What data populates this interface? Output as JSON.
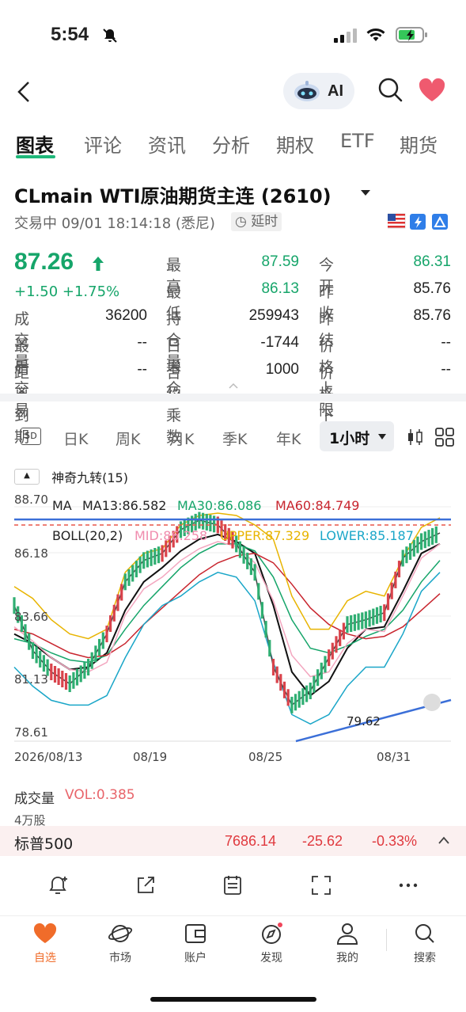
{
  "status": {
    "time": "5:54"
  },
  "header": {
    "ai_label": "AI"
  },
  "tabs": [
    "图表",
    "评论",
    "资讯",
    "分析",
    "期权",
    "ETF",
    "期货"
  ],
  "instrument": {
    "title": "CLmain   WTI原油期货主连 (2610)",
    "status_line": "交易中 09/01 18:14:18 (悉尼)",
    "delay": "延时",
    "price": "87.26",
    "change": "+1.50  +1.75%"
  },
  "quote_grid": [
    {
      "label": "最高",
      "value": "87.59",
      "green": true
    },
    {
      "label": "今开",
      "value": "86.31",
      "green": true
    },
    {
      "label": "最低",
      "value": "86.13",
      "green": true
    },
    {
      "label": "昨收",
      "value": "85.76",
      "green": false
    },
    {
      "label": "成交量",
      "value": "36200",
      "green": false
    },
    {
      "label": "持仓量",
      "value": "259943",
      "green": false
    },
    {
      "label": "昨结",
      "value": "85.76",
      "green": false
    },
    {
      "label": "最后交易",
      "value": "--",
      "green": false
    },
    {
      "label": "日增仓",
      "value": "-1744",
      "green": false
    },
    {
      "label": "价格上限",
      "value": "--",
      "green": false
    },
    {
      "label": "距离到期",
      "value": "--",
      "green": false
    },
    {
      "label": "合约乘数",
      "value": "1000",
      "green": false
    },
    {
      "label": "价格下限",
      "value": "--",
      "green": false
    }
  ],
  "periods": {
    "badge": "5D",
    "items": [
      "日K",
      "周K",
      "月K",
      "季K",
      "年K"
    ],
    "active": "1小时"
  },
  "indicators": {
    "magic": "神奇九转(15)",
    "ma_label": "MA",
    "ma13": "MA13:86.582",
    "ma30": "MA30:86.086",
    "ma60": "MA60:84.749",
    "boll": "BOLL(20,2)",
    "mid": "MID:86.258",
    "upper": "UPPER:87.329",
    "lower": "LOWER:85.187"
  },
  "chart_data": {
    "type": "line",
    "title": "",
    "y_ticks": [
      "88.70",
      "86.18",
      "83.66",
      "81.13",
      "78.61"
    ],
    "x_ticks": [
      "2026/08/13",
      "08/19",
      "08/25",
      "08/31"
    ],
    "ylim": [
      78.61,
      88.7
    ],
    "low_annotation": "79.62",
    "series": [
      {
        "name": "MA13",
        "color": "#111111",
        "values": [
          83.0,
          82.6,
          82.0,
          81.5,
          81.6,
          82.2,
          84.0,
          85.2,
          85.8,
          86.5,
          87.0,
          87.2,
          86.9,
          86.4,
          84.2,
          81.4,
          80.4,
          81.0,
          82.4,
          83.2,
          83.3,
          84.8,
          86.4,
          86.8
        ]
      },
      {
        "name": "MA30",
        "color": "#16a56a",
        "values": [
          82.8,
          82.6,
          82.2,
          81.9,
          81.8,
          82.1,
          83.2,
          84.2,
          85.0,
          85.8,
          86.4,
          86.8,
          86.8,
          86.5,
          85.4,
          83.6,
          82.4,
          82.2,
          82.5,
          82.9,
          83.2,
          84.0,
          85.2,
          86.1
        ]
      },
      {
        "name": "MA60",
        "color": "#c8252e",
        "values": [
          83.2,
          83.0,
          82.6,
          82.2,
          82.0,
          82.1,
          82.6,
          83.4,
          84.1,
          84.8,
          85.5,
          86.0,
          86.3,
          86.4,
          86.0,
          85.1,
          84.1,
          83.4,
          83.0,
          82.8,
          82.9,
          83.3,
          84.0,
          84.7
        ]
      },
      {
        "name": "UPPER",
        "color": "#e8b400",
        "values": [
          85.0,
          84.5,
          83.6,
          83.0,
          82.8,
          83.2,
          85.6,
          86.4,
          86.6,
          87.6,
          88.0,
          88.1,
          88.0,
          87.6,
          87.0,
          84.6,
          83.2,
          83.2,
          84.4,
          84.8,
          84.6,
          86.2,
          87.5,
          87.9
        ]
      },
      {
        "name": "LOWER",
        "color": "#1aa6c8",
        "values": [
          81.6,
          80.8,
          80.2,
          80.0,
          80.0,
          80.4,
          82.0,
          83.4,
          84.2,
          84.6,
          85.2,
          85.6,
          85.4,
          84.4,
          81.8,
          79.6,
          79.2,
          79.6,
          80.8,
          81.6,
          81.6,
          83.0,
          84.8,
          85.6
        ]
      },
      {
        "name": "MID",
        "color": "#f3a6bf",
        "values": [
          83.3,
          82.7,
          82.0,
          81.5,
          81.4,
          81.8,
          83.8,
          84.9,
          85.4,
          86.1,
          86.6,
          86.9,
          86.7,
          86.0,
          84.4,
          82.1,
          81.2,
          81.4,
          82.6,
          83.2,
          83.1,
          84.6,
          86.2,
          86.8
        ]
      },
      {
        "name": "",
        "color": "#444444",
        "values": [
          84.2,
          82.3,
          81.4,
          80.9,
          81.6,
          83.0,
          85.2,
          86.1,
          86.4,
          87.4,
          87.8,
          87.6,
          86.8,
          85.6,
          81.6,
          80.0,
          80.6,
          82.0,
          83.4,
          83.6,
          83.9,
          86.2,
          86.9,
          87.26
        ]
      }
    ]
  },
  "volume": {
    "label": "成交量",
    "vol": "VOL:0.385",
    "scale": "4万股"
  },
  "ticker": {
    "name": "标普500",
    "value": "7686.14",
    "change": "-25.62",
    "pct": "-0.33%"
  },
  "nav": [
    {
      "label": "自选",
      "active": true
    },
    {
      "label": "市场",
      "active": false
    },
    {
      "label": "账户",
      "active": false
    },
    {
      "label": "发现",
      "active": false
    },
    {
      "label": "我的",
      "active": false
    },
    {
      "label": "搜索",
      "active": false
    }
  ],
  "colors": {
    "green": "#16a56a",
    "red": "#e0393e",
    "accent": "#f06c2a",
    "blue_line": "#3b6fd8"
  }
}
